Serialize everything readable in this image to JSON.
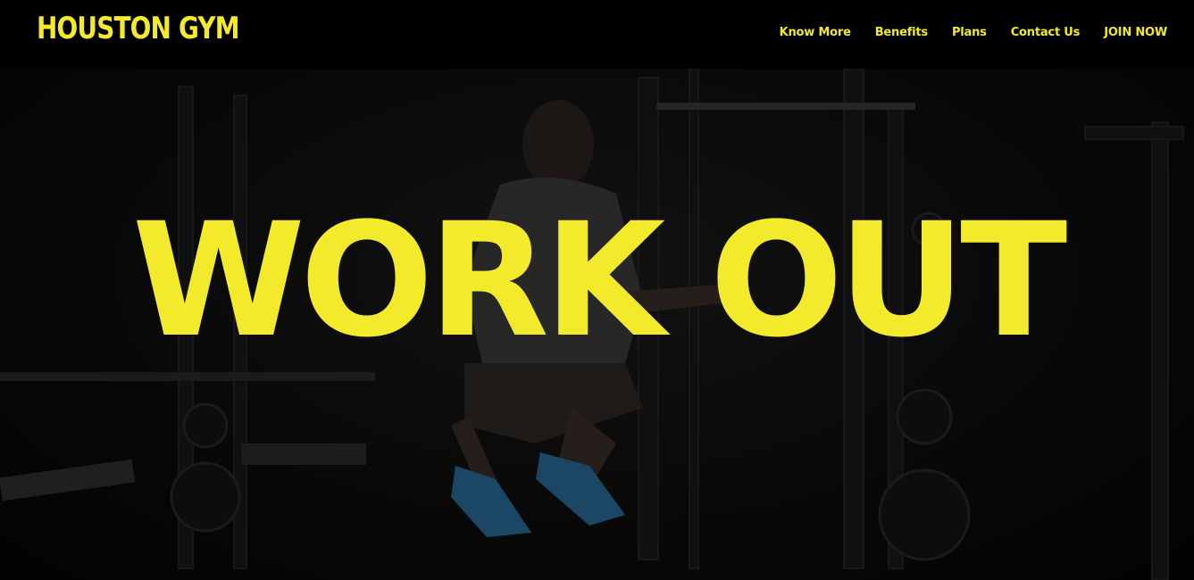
{
  "brand": {
    "name": "HOUSTON GYM"
  },
  "nav": {
    "items": [
      {
        "label": "Know More"
      },
      {
        "label": "Benefits"
      },
      {
        "label": "Plans"
      },
      {
        "label": "Contact Us"
      },
      {
        "label": "JOIN NOW"
      }
    ]
  },
  "hero": {
    "headline": "WORK OUT",
    "background_image": "gym-athlete-box-jump-photo"
  },
  "colors": {
    "accent": "#f2ea2a",
    "background": "#000000"
  }
}
